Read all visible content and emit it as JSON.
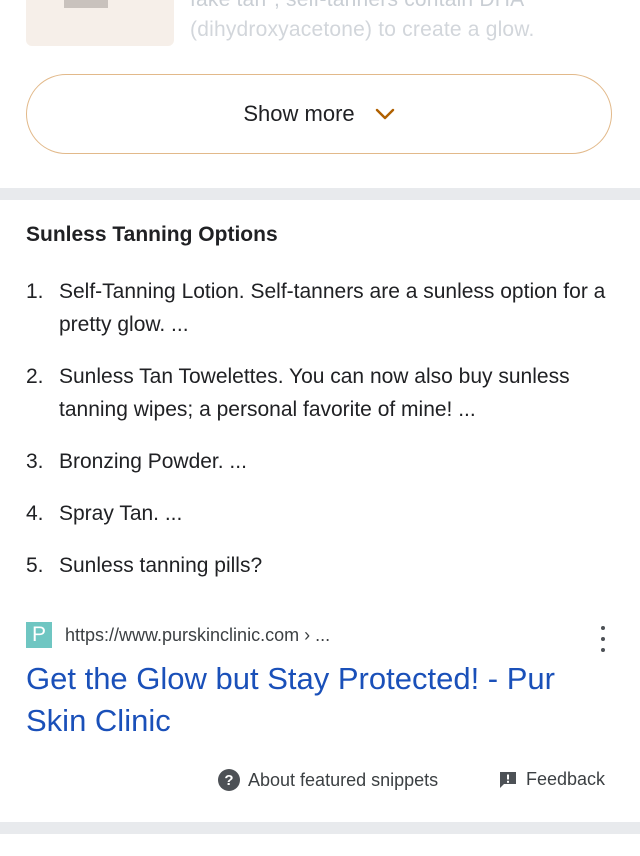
{
  "previous_result": {
    "thumb_icon": "image-placeholder",
    "line1": "fake tan\", self-tanners contain DHA",
    "line2": "(dihydroxyacetone) to create a glow."
  },
  "show_more": {
    "label": "Show more",
    "icon": "chevron-down-icon"
  },
  "snippet": {
    "heading": "Sunless Tanning Options",
    "items": [
      {
        "num": "1.",
        "text": "Self-Tanning Lotion. Self-tanners are a sunless option for a pretty glow. ..."
      },
      {
        "num": "2.",
        "text": "Sunless Tan Towelettes. You can now also buy sunless tanning wipes; a personal favorite of mine! ..."
      },
      {
        "num": "3.",
        "text": "Bronzing Powder. ..."
      },
      {
        "num": "4.",
        "text": "Spray Tan. ..."
      },
      {
        "num": "5.",
        "text": "Sunless tanning pills?"
      }
    ]
  },
  "source": {
    "favicon_letter": "P",
    "favicon_color": "#6fc6c2",
    "url": "https://www.purskinclinic.com › ...",
    "title": "Get the Glow but Stay Protected! - Pur Skin Clinic",
    "title_color": "#1a50b9"
  },
  "footer": {
    "about_label": "About featured snippets",
    "about_icon": "help-icon",
    "feedback_label": "Feedback",
    "feedback_icon": "feedback-icon"
  },
  "colors": {
    "accent_border": "#e2b98a",
    "divider": "#e8eaed"
  }
}
